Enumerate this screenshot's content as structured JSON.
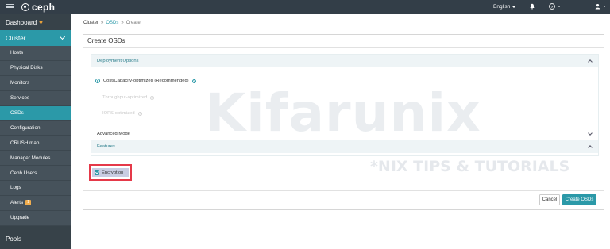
{
  "app": {
    "logo_text": "ceph"
  },
  "topbar": {
    "language": "English",
    "notifications_icon": "bell-icon",
    "help_icon": "question-circle-icon",
    "user_icon": "user-icon"
  },
  "sidebar": {
    "dashboard": "Dashboard",
    "cluster": "Cluster",
    "items": [
      {
        "label": "Hosts"
      },
      {
        "label": "Physical Disks"
      },
      {
        "label": "Monitors"
      },
      {
        "label": "Services"
      },
      {
        "label": "OSDs"
      },
      {
        "label": "Configuration"
      },
      {
        "label": "CRUSH map"
      },
      {
        "label": "Manager Modules"
      },
      {
        "label": "Ceph Users"
      },
      {
        "label": "Logs"
      },
      {
        "label": "Alerts",
        "badge": "1"
      },
      {
        "label": "Upgrade"
      }
    ],
    "pools": "Pools",
    "active_item": "OSDs"
  },
  "breadcrumb": {
    "first": "Cluster",
    "second": "OSDs",
    "third": "Create",
    "separator": "»"
  },
  "card": {
    "title": "Create OSDs",
    "deployment_options": "Deployment Options",
    "options": [
      {
        "label": "Cost/Capacity-optimized (Recommended)",
        "selected": true
      },
      {
        "label": "Throughput-optimized",
        "selected": false
      },
      {
        "label": "IOPS-optimized",
        "selected": false
      }
    ],
    "advanced_mode": "Advanced Mode",
    "features": "Features",
    "encryption_label": "Encryption",
    "encryption_checked": true,
    "cancel": "Cancel",
    "create": "Create OSDs"
  },
  "watermark": {
    "main": "Kifarunix",
    "sub": "*NIX TIPS & TUTORIALS"
  },
  "colors": {
    "accent": "#2b99a8",
    "topbar": "#333e48",
    "sidebar": "#374249",
    "highlight_border": "#e53949"
  }
}
